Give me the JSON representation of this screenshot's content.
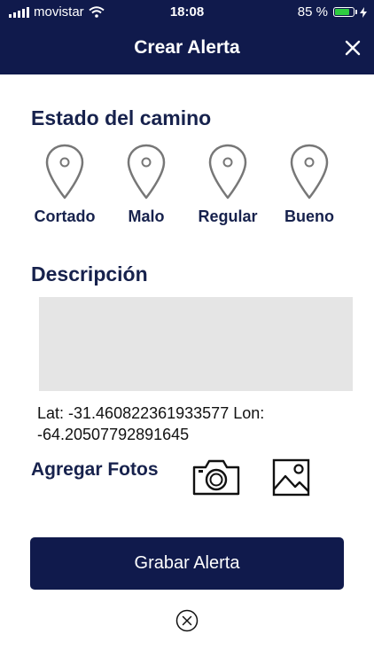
{
  "status_bar": {
    "carrier": "movistar",
    "time": "18:08",
    "battery_text": "85 %",
    "battery_level": 0.85
  },
  "header": {
    "title": "Crear Alerta"
  },
  "road_state": {
    "title": "Estado del camino",
    "options": [
      {
        "label": "Cortado"
      },
      {
        "label": "Malo"
      },
      {
        "label": "Regular"
      },
      {
        "label": "Bueno"
      }
    ]
  },
  "description": {
    "title": "Descripción",
    "value": ""
  },
  "location": {
    "text": "Lat: -31.460822361933577 Lon: -64.20507792891645"
  },
  "photos": {
    "title": "Agregar Fotos"
  },
  "actions": {
    "save_label": "Grabar Alerta"
  },
  "colors": {
    "primary": "#101a4c",
    "text": "#17224d",
    "input_bg": "#e5e5e5",
    "battery": "#2ecc40"
  }
}
